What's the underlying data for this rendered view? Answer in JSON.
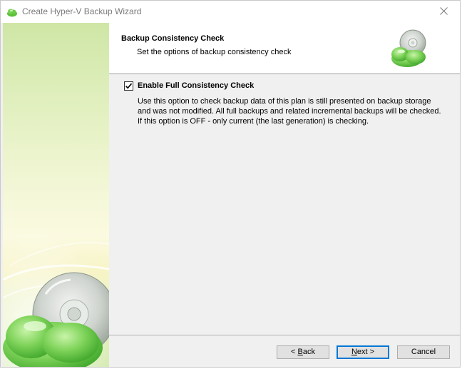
{
  "window": {
    "title": "Create Hyper-V Backup Wizard",
    "icon": "hyperv-backup-app-icon"
  },
  "header": {
    "title": "Backup Consistency Check",
    "subtitle": "Set the options of backup consistency check",
    "logo": "backup-disc-cloud-logo"
  },
  "option": {
    "label": "Enable Full Consistency Check",
    "checked": true,
    "description_lines": [
      "Use this option to check backup data of this plan is still presented on backup storage",
      "and was not modified. All full backups and related incremental backups will be checked.",
      "If this option is OFF - only current (the last generation) is checking."
    ]
  },
  "buttons": {
    "back": {
      "prefix": "< ",
      "mnemonic": "B",
      "rest": "ack"
    },
    "next": {
      "mnemonic": "N",
      "rest": "ext >"
    },
    "cancel": "Cancel"
  },
  "colors": {
    "accent": "#0078d7",
    "side_panel_green": "#cfe6a6",
    "cloud_green": "#5cc23a"
  }
}
